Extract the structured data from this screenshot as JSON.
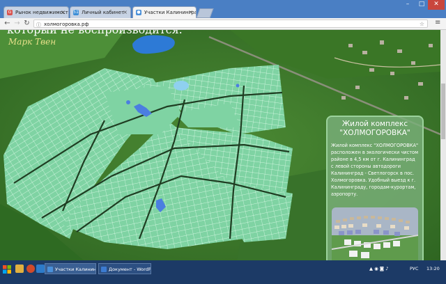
{
  "browser": {
    "tabs": [
      {
        "label": "Рынок недвижимости ∙",
        "icon": "G",
        "color": "#d9534f"
      },
      {
        "label": "Личный кабинет",
        "icon": "51",
        "color": "#3b8ed6"
      },
      {
        "label": "Участки Калининград∙",
        "icon": "●",
        "color": "#4a90d9"
      }
    ],
    "url": "холмогоровка.рф",
    "window_controls": {
      "minimize": "–",
      "maximize": "□",
      "close": "✕"
    }
  },
  "page": {
    "quote_text": "который не воспроизводится.",
    "quote_author": "Марк Твен",
    "info": {
      "title_line1": "Жилой комплекс",
      "title_line2": "\"ХОЛМОГОРОВКА\"",
      "text": "Жилой комплекс \"ХОЛМОГОРОВКА\" расположен в экологически чистом районе в 4,5 км от г. Калининград с левой стороны автодороги Калининград - Светлогорск в пос. Холмогоровка. Удобный выезд к г. Калининграду, городам-курортам, аэропорту."
    }
  },
  "taskbar": {
    "tasks": [
      {
        "label": "Участки Калинингр...",
        "color": "#4a90d9"
      },
      {
        "label": "Документ - WordPad",
        "color": "#3c7bd0"
      }
    ],
    "lang": "РУС",
    "time": "13:20"
  },
  "colors": {
    "plot_fill": "#7fd3a3",
    "plot_line": "#e8fff0",
    "road": "#1f3d22"
  }
}
